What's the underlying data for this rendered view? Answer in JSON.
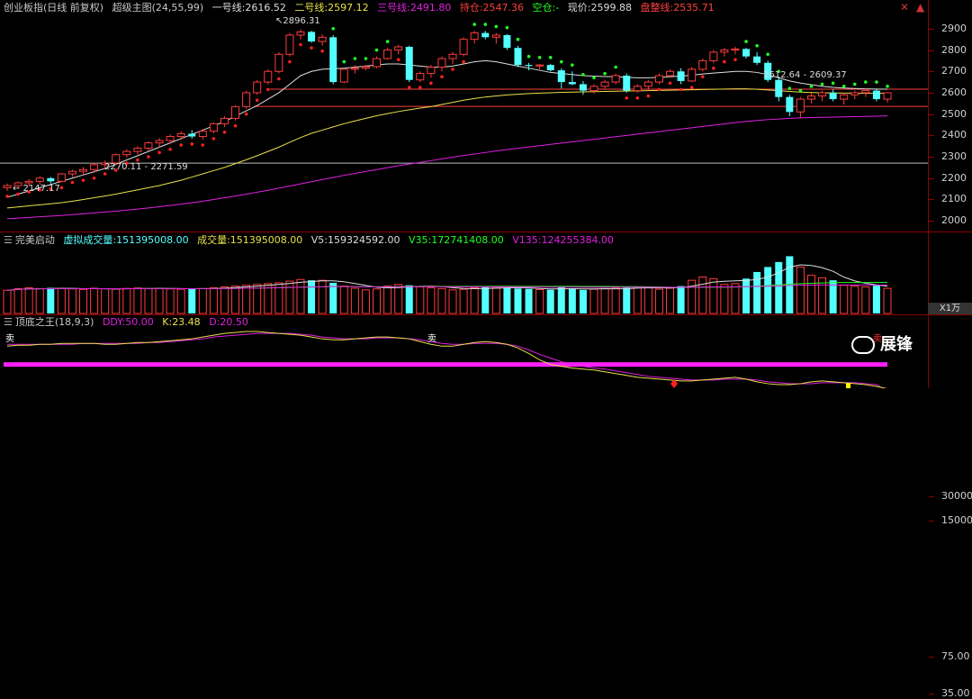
{
  "main_header": {
    "name": "创业板指(日线 前复权)",
    "indicator": "超级主图(24,55,99)",
    "l1_label": "一号线:",
    "l1_val": "2616.52",
    "l2_label": "二号线:",
    "l2_val": "2597.12",
    "l3_label": "三号线:",
    "l3_val": "2491.80",
    "hold_label": "持仓:",
    "hold_val": "2547.36",
    "empty_label": "空仓:",
    "empty_val": "-",
    "price_label": "现价:",
    "price_val": "2599.88",
    "pan_label": "盘整线:",
    "pan_val": "2535.71"
  },
  "vol_header": {
    "name": "完美启动",
    "vvol_label": "虚拟成交量:",
    "vvol_val": "151395008.00",
    "vol_label": "成交量:",
    "vol_val": "151395008.00",
    "v5_label": "V5:",
    "v5_val": "159324592.00",
    "v35_label": "V35:",
    "v35_val": "172741408.00",
    "v135_label": "V135:",
    "v135_val": "124255384.00"
  },
  "kdj_header": {
    "name": "顶底之王",
    "params": "(18,9,3)",
    "ddy_label": "DDY:",
    "ddy_val": "50.00",
    "k_label": "K:",
    "k_val": "23.48",
    "d_label": "D:",
    "d_val": "20.50"
  },
  "annotations": {
    "high": "2896.31",
    "low_left": "2147.17",
    "mid_left": "2270.11 - 2271.59",
    "right": "2612.64 - 2609.37",
    "sell": "卖"
  },
  "vol_unit": "X1万",
  "watermark": "展锋",
  "colors": {
    "up": "#ff3c3c",
    "down": "#54ffff",
    "line1": "#dddddd",
    "line2": "#e8e04a",
    "line3": "#e020e0",
    "dotsUp": "#ff2020",
    "dotsDown": "#20ff20"
  },
  "chart_data": [
    {
      "type": "candlestick",
      "panel": "main",
      "ylim": [
        1950,
        2950
      ],
      "yticks": [
        2000,
        2100,
        2200,
        2300,
        2400,
        2500,
        2600,
        2700,
        2800,
        2900
      ],
      "ref_lines": [
        2270,
        2535.71,
        2616.52
      ],
      "candles": [
        [
          2155,
          2175,
          2140,
          2165
        ],
        [
          2165,
          2185,
          2150,
          2178
        ],
        [
          2178,
          2195,
          2160,
          2185
        ],
        [
          2185,
          2210,
          2170,
          2200
        ],
        [
          2200,
          2205,
          2175,
          2185
        ],
        [
          2185,
          2225,
          2180,
          2220
        ],
        [
          2220,
          2240,
          2205,
          2232
        ],
        [
          2232,
          2252,
          2215,
          2240
        ],
        [
          2240,
          2270,
          2225,
          2263
        ],
        [
          2263,
          2282,
          2245,
          2271
        ],
        [
          2271,
          2315,
          2262,
          2310
        ],
        [
          2310,
          2335,
          2295,
          2325
        ],
        [
          2325,
          2350,
          2310,
          2340
        ],
        [
          2340,
          2372,
          2325,
          2365
        ],
        [
          2365,
          2388,
          2345,
          2376
        ],
        [
          2376,
          2405,
          2360,
          2395
        ],
        [
          2395,
          2420,
          2380,
          2408
        ],
        [
          2408,
          2425,
          2385,
          2395
        ],
        [
          2395,
          2430,
          2380,
          2420
        ],
        [
          2420,
          2460,
          2410,
          2455
        ],
        [
          2455,
          2490,
          2440,
          2480
        ],
        [
          2480,
          2540,
          2470,
          2535
        ],
        [
          2535,
          2610,
          2525,
          2600
        ],
        [
          2600,
          2660,
          2590,
          2650
        ],
        [
          2650,
          2710,
          2640,
          2700
        ],
        [
          2700,
          2790,
          2690,
          2780
        ],
        [
          2780,
          2880,
          2770,
          2870
        ],
        [
          2870,
          2896,
          2850,
          2885
        ],
        [
          2885,
          2890,
          2835,
          2840
        ],
        [
          2840,
          2875,
          2820,
          2860
        ],
        [
          2860,
          2870,
          2640,
          2650
        ],
        [
          2650,
          2715,
          2645,
          2710
        ],
        [
          2710,
          2730,
          2690,
          2715
        ],
        [
          2715,
          2730,
          2705,
          2722
        ],
        [
          2722,
          2770,
          2715,
          2760
        ],
        [
          2760,
          2810,
          2755,
          2800
        ],
        [
          2800,
          2825,
          2780,
          2815
        ],
        [
          2815,
          2820,
          2650,
          2660
        ],
        [
          2660,
          2700,
          2650,
          2690
        ],
        [
          2690,
          2730,
          2670,
          2720
        ],
        [
          2720,
          2770,
          2700,
          2760
        ],
        [
          2760,
          2790,
          2735,
          2780
        ],
        [
          2780,
          2860,
          2770,
          2850
        ],
        [
          2850,
          2890,
          2830,
          2880
        ],
        [
          2880,
          2890,
          2850,
          2860
        ],
        [
          2860,
          2880,
          2830,
          2870
        ],
        [
          2870,
          2875,
          2800,
          2810
        ],
        [
          2810,
          2820,
          2720,
          2730
        ],
        [
          2730,
          2740,
          2705,
          2725
        ],
        [
          2725,
          2735,
          2710,
          2730
        ],
        [
          2730,
          2735,
          2700,
          2705
        ],
        [
          2705,
          2715,
          2620,
          2650
        ],
        [
          2650,
          2700,
          2635,
          2640
        ],
        [
          2640,
          2655,
          2590,
          2610
        ],
        [
          2610,
          2640,
          2595,
          2630
        ],
        [
          2630,
          2660,
          2620,
          2650
        ],
        [
          2650,
          2690,
          2640,
          2680
        ],
        [
          2680,
          2690,
          2600,
          2610
        ],
        [
          2610,
          2640,
          2600,
          2630
        ],
        [
          2630,
          2660,
          2610,
          2650
        ],
        [
          2650,
          2690,
          2640,
          2680
        ],
        [
          2680,
          2710,
          2670,
          2700
        ],
        [
          2700,
          2715,
          2640,
          2655
        ],
        [
          2655,
          2720,
          2650,
          2710
        ],
        [
          2710,
          2760,
          2700,
          2750
        ],
        [
          2750,
          2800,
          2740,
          2790
        ],
        [
          2790,
          2810,
          2770,
          2800
        ],
        [
          2800,
          2815,
          2780,
          2805
        ],
        [
          2805,
          2810,
          2760,
          2770
        ],
        [
          2770,
          2790,
          2730,
          2740
        ],
        [
          2740,
          2750,
          2650,
          2660
        ],
        [
          2660,
          2670,
          2560,
          2580
        ],
        [
          2580,
          2590,
          2490,
          2510
        ],
        [
          2510,
          2580,
          2480,
          2570
        ],
        [
          2570,
          2600,
          2550,
          2585
        ],
        [
          2585,
          2610,
          2560,
          2600
        ],
        [
          2600,
          2615,
          2560,
          2570
        ],
        [
          2570,
          2600,
          2545,
          2590
        ],
        [
          2590,
          2610,
          2570,
          2600
        ],
        [
          2600,
          2620,
          2580,
          2610
        ],
        [
          2610,
          2620,
          2560,
          2570
        ],
        [
          2570,
          2600,
          2555,
          2599.88
        ]
      ],
      "line1": [
        2110,
        2125,
        2140,
        2155,
        2170,
        2185,
        2200,
        2215,
        2230,
        2245,
        2265,
        2285,
        2305,
        2325,
        2345,
        2365,
        2385,
        2405,
        2425,
        2445,
        2465,
        2490,
        2515,
        2540,
        2570,
        2600,
        2640,
        2680,
        2700,
        2710,
        2712,
        2715,
        2720,
        2725,
        2730,
        2735,
        2735,
        2730,
        2725,
        2720,
        2720,
        2725,
        2735,
        2745,
        2750,
        2745,
        2735,
        2725,
        2715,
        2705,
        2695,
        2690,
        2685,
        2680,
        2678,
        2676,
        2675,
        2672,
        2670,
        2670,
        2672,
        2675,
        2678,
        2682,
        2688,
        2692,
        2696,
        2700,
        2700,
        2695,
        2685,
        2670,
        2655,
        2645,
        2638,
        2630,
        2625,
        2622,
        2620,
        2618,
        2617,
        2616.52
      ],
      "line2": [
        2060,
        2065,
        2070,
        2075,
        2080,
        2085,
        2092,
        2100,
        2108,
        2116,
        2125,
        2135,
        2145,
        2155,
        2165,
        2178,
        2190,
        2205,
        2220,
        2235,
        2250,
        2268,
        2286,
        2305,
        2325,
        2345,
        2368,
        2390,
        2410,
        2425,
        2440,
        2455,
        2468,
        2480,
        2492,
        2502,
        2512,
        2520,
        2528,
        2535,
        2545,
        2555,
        2565,
        2573,
        2580,
        2585,
        2590,
        2593,
        2596,
        2598,
        2600,
        2602,
        2603,
        2604,
        2605,
        2606,
        2607,
        2608,
        2609,
        2610,
        2611,
        2612,
        2613,
        2614,
        2615,
        2616,
        2617,
        2618,
        2618,
        2616,
        2613,
        2610,
        2606,
        2603,
        2601,
        2600,
        2599,
        2598,
        2598,
        2597,
        2597,
        2597.12
      ],
      "line3": [
        2010,
        2013,
        2016,
        2019,
        2022,
        2025,
        2029,
        2033,
        2037,
        2041,
        2045,
        2050,
        2055,
        2060,
        2066,
        2072,
        2078,
        2085,
        2092,
        2100,
        2108,
        2116,
        2125,
        2134,
        2143,
        2153,
        2163,
        2173,
        2183,
        2193,
        2203,
        2213,
        2222,
        2231,
        2240,
        2249,
        2258,
        2266,
        2274,
        2282,
        2290,
        2298,
        2306,
        2313,
        2320,
        2327,
        2334,
        2340,
        2346,
        2352,
        2358,
        2364,
        2370,
        2376,
        2382,
        2388,
        2394,
        2400,
        2406,
        2412,
        2418,
        2424,
        2430,
        2436,
        2442,
        2448,
        2454,
        2460,
        2466,
        2470,
        2474,
        2477,
        2480,
        2482,
        2484,
        2485,
        2486,
        2487,
        2488,
        2489,
        2490,
        2491.8
      ]
    },
    {
      "type": "bar",
      "panel": "volume",
      "ylim": [
        0,
        38000
      ],
      "yticks": [
        15000,
        30000
      ],
      "unit": "X1万",
      "values": [
        14000,
        15000,
        15500,
        15000,
        15500,
        15000,
        14800,
        14500,
        15200,
        14900,
        14700,
        15100,
        15300,
        15000,
        15200,
        14800,
        14600,
        15200,
        15000,
        15500,
        16000,
        16500,
        17000,
        17500,
        18000,
        18500,
        19500,
        20500,
        20000,
        20000,
        18500,
        16500,
        15200,
        14200,
        14800,
        16500,
        17500,
        17000,
        16000,
        15500,
        15000,
        14200,
        14600,
        15500,
        16000,
        15800,
        15400,
        15000,
        14800,
        14400,
        14300,
        15800,
        15200,
        14200,
        14600,
        15000,
        15200,
        15500,
        16000,
        15800,
        14600,
        15200,
        16500,
        20000,
        22000,
        21000,
        17500,
        18000,
        21000,
        25000,
        28000,
        31000,
        34500,
        28000,
        23000,
        21500,
        20000,
        17000,
        16500,
        16000,
        17000,
        15139
      ]
    },
    {
      "type": "line",
      "panel": "oscillator",
      "ylim": [
        25,
        90
      ],
      "yticks": [
        35,
        75
      ],
      "series": [
        {
          "name": "K",
          "values": [
            70,
            71,
            71,
            72,
            72,
            73,
            73,
            73,
            73,
            72,
            72,
            73,
            74,
            74,
            75,
            76,
            77,
            78,
            80,
            82,
            84,
            85,
            86,
            86,
            85,
            84,
            83,
            82,
            80,
            78,
            77,
            77,
            78,
            79,
            80,
            80,
            79,
            78,
            75,
            72,
            70,
            70,
            72,
            74,
            75,
            74,
            72,
            68,
            62,
            55,
            50,
            48,
            46,
            45,
            44,
            42,
            40,
            38,
            36,
            35,
            34,
            33,
            32,
            32,
            33,
            34,
            35,
            36,
            34,
            31,
            29,
            28,
            28,
            29,
            31,
            32,
            31,
            30,
            29,
            28,
            26,
            23.48
          ]
        },
        {
          "name": "D",
          "values": [
            72,
            72,
            72,
            72,
            72,
            72,
            72,
            73,
            73,
            73,
            73,
            73,
            73,
            74,
            74,
            75,
            76,
            77,
            78,
            80,
            81,
            82,
            83,
            84,
            84,
            84,
            84,
            83,
            82,
            80,
            79,
            78,
            78,
            78,
            79,
            79,
            79,
            78,
            77,
            75,
            73,
            72,
            72,
            73,
            73,
            73,
            72,
            70,
            66,
            61,
            57,
            53,
            50,
            48,
            46,
            45,
            43,
            41,
            39,
            37,
            36,
            35,
            34,
            33,
            33,
            33,
            34,
            34,
            34,
            33,
            31,
            30,
            29,
            29,
            29,
            30,
            30,
            30,
            30,
            29,
            28,
            20.5
          ]
        }
      ],
      "ddy": 50.0
    }
  ]
}
